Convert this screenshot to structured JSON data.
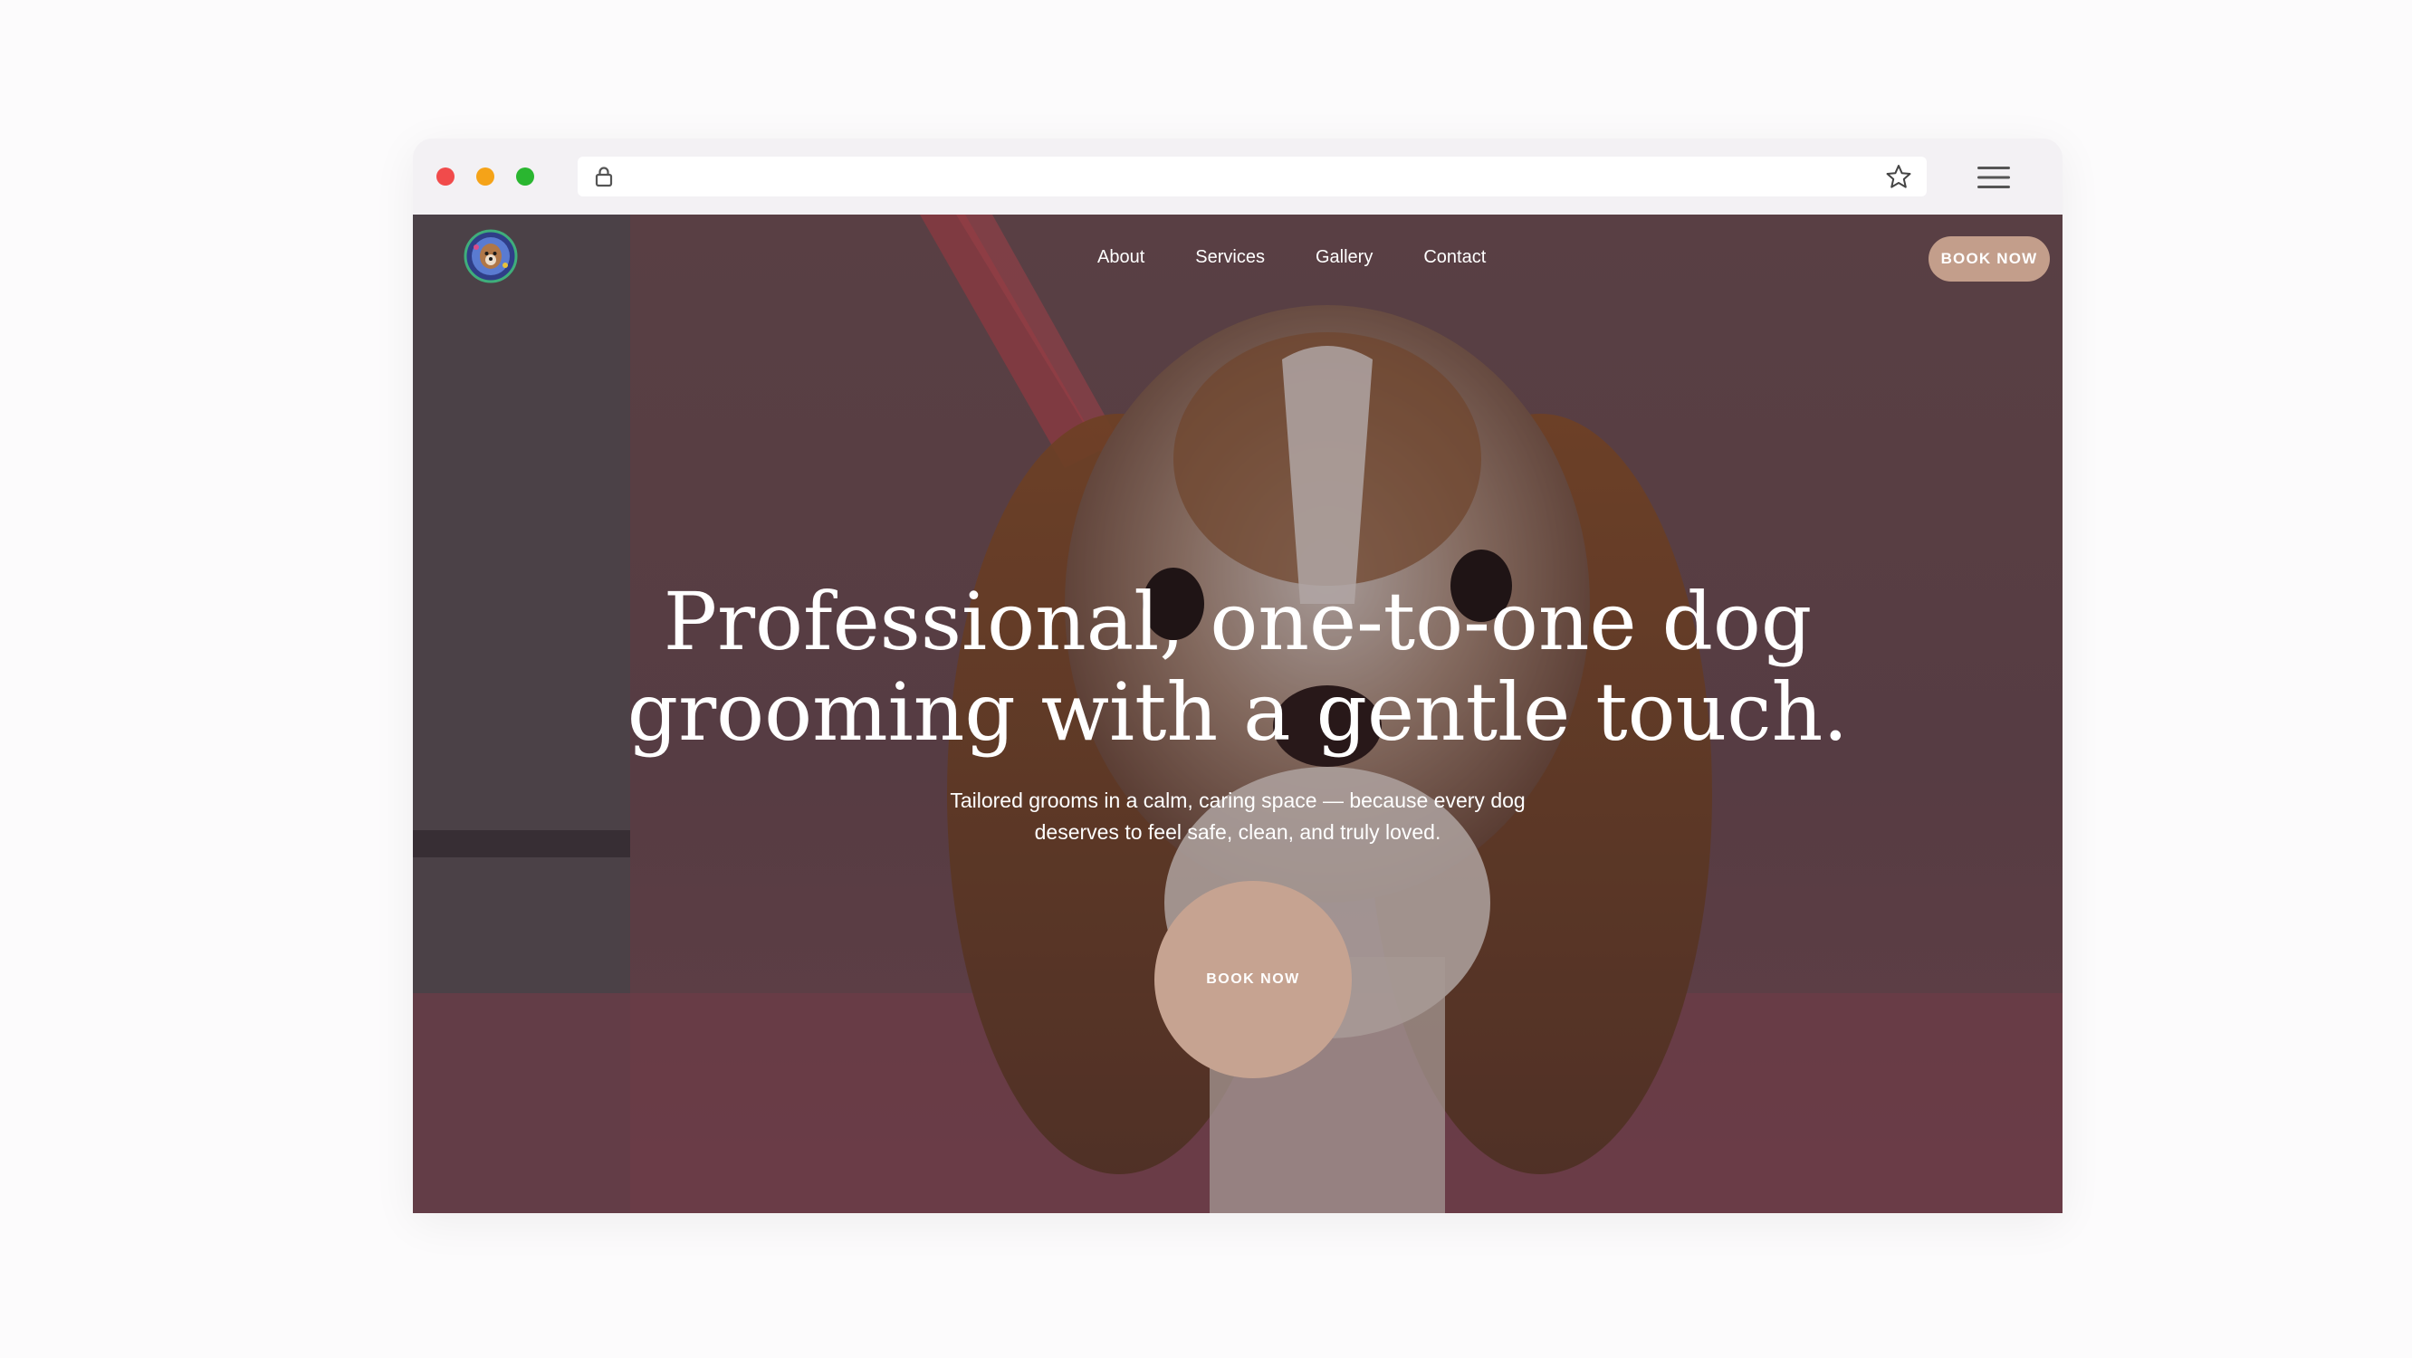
{
  "browser": {
    "controls": [
      "close",
      "minimize",
      "maximize"
    ],
    "url": "",
    "icons": [
      "lock-icon",
      "star-icon",
      "hamburger-menu-icon"
    ]
  },
  "site": {
    "logo_alt": "dog grooming logo",
    "nav": [
      {
        "label": "About"
      },
      {
        "label": "Services"
      },
      {
        "label": "Gallery"
      },
      {
        "label": "Contact"
      }
    ],
    "header_cta": "BOOK NOW",
    "hero": {
      "headline_line1": "Professional, one-to-one dog",
      "headline_line2": "grooming with a gentle touch.",
      "subtext_line1": "Tailored grooms in a calm, caring space — because every dog",
      "subtext_line2": "deserves to feel safe, clean, and truly loved.",
      "cta": "BOOK NOW"
    }
  },
  "colors": {
    "accent": "#c6a391",
    "traffic_red": "#f14b4b",
    "traffic_yellow": "#f5a318",
    "traffic_green": "#2ab630"
  }
}
